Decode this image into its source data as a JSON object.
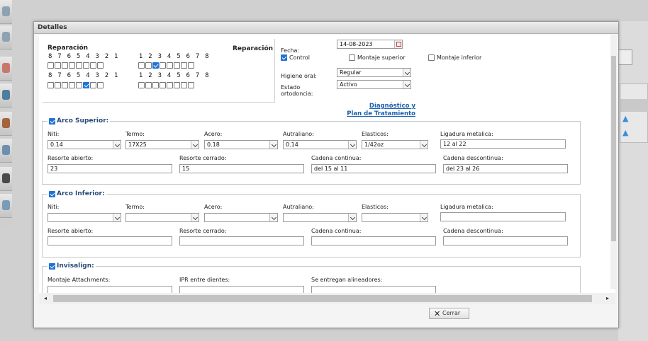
{
  "dialog": {
    "title": "Detalles",
    "close_label": "Cerrar"
  },
  "reparacion": {
    "label_left": "Reparación",
    "label_right": "Reparación",
    "upper_left_nums": "8 7 6 5 4 3 2 1",
    "upper_right_nums": "1 2 3 4 5 6 7 8",
    "lower_left_nums": "8 7 6 5 4 3 2 1",
    "lower_right_nums": "1 2 3 4 5 6 7 8"
  },
  "fecha": {
    "label": "Fecha:",
    "value": "14-08-2023"
  },
  "options": {
    "control": "Control",
    "montaje_superior": "Montaje superior",
    "montaje_inferior": "Montaje inferior"
  },
  "higiene": {
    "label": "Higiene oral:",
    "value": "Regular"
  },
  "estado": {
    "label_line1": "Estado",
    "label_line2": "ortodoncia:",
    "value": "Activo"
  },
  "diagnostico": {
    "line1": "Diagnóstico y",
    "line2": "Plan de Tratamiento"
  },
  "arco_superior": {
    "title": "Arco Superior:",
    "niti_label": "Niti:",
    "niti": "0.14",
    "termo_label": "Termo:",
    "termo": "17X25",
    "acero_label": "Acero:",
    "acero": "0.18",
    "autraliano_label": "Autraliano:",
    "autraliano": "0.14",
    "elasticos_label": "Elasticos:",
    "elasticos": "1/42oz",
    "ligadura_label": "Ligadura metalica:",
    "ligadura": "12 al 22",
    "resorte_abierto_label": "Resorte abierto:",
    "resorte_abierto": "23",
    "resorte_cerrado_label": "Resorte cerrado:",
    "resorte_cerrado": "15",
    "cadena_continua_label": "Cadena continua:",
    "cadena_continua": "del 15 al 11",
    "cadena_descontinua_label": "Cadena descontinua:",
    "cadena_descontinua": " del 23 al 26"
  },
  "arco_inferior": {
    "title": "Arco Inferior:",
    "niti_label": "Niti:",
    "termo_label": "Termo:",
    "acero_label": "Acero:",
    "autraliano_label": "Autraliano:",
    "elasticos_label": "Elasticos:",
    "ligadura_label": "Ligadura metalica:",
    "resorte_abierto_label": "Resorte abierto:",
    "resorte_cerrado_label": "Resorte cerrado:",
    "cadena_continua_label": "Cadena continua:",
    "cadena_descontinua_label": "Cadena descontinua:"
  },
  "invisalign": {
    "title": "Invisalign:",
    "montaje_label": "Montaje Attachments:",
    "ipr_label": "IPR entre dientes:",
    "entregan_label": "Se entregan alineadores:"
  },
  "colors": {
    "accent": "#1e73d6",
    "link": "#1c5fb0",
    "legend": "#264b7a"
  }
}
